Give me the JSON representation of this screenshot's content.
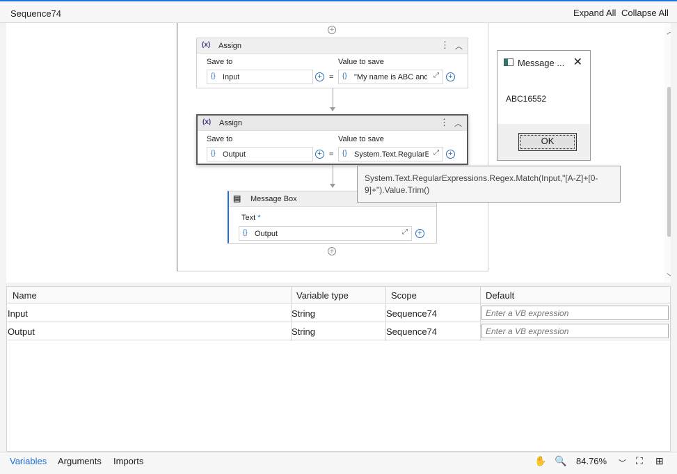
{
  "header": {
    "title": "Sequence74",
    "expand_all": "Expand All",
    "collapse_all": "Collapse All"
  },
  "workflow": {
    "assign1": {
      "title": "Assign",
      "save_to_label": "Save to",
      "value_label": "Value to save",
      "save_to_value": "Input",
      "value": "\"My name is ABC and"
    },
    "assign2": {
      "title": "Assign",
      "save_to_label": "Save to",
      "value_label": "Value to save",
      "save_to_value": "Output",
      "value": "System.Text.RegularExpres"
    },
    "messagebox": {
      "title": "Message Box",
      "text_label": "Text",
      "required_mark": "*",
      "text_value": "Output"
    },
    "tooltip": "System.Text.RegularExpressions.Regex.Match(Input,\"[A-Z]+[0-9]+\").Value.Trim()"
  },
  "dialog": {
    "title": "Message ...",
    "message": "ABC16552",
    "ok": "OK"
  },
  "variables": {
    "columns": [
      "Name",
      "Variable type",
      "Scope",
      "Default"
    ],
    "rows": [
      {
        "name": "Input",
        "type": "String",
        "scope": "Sequence74",
        "default_placeholder": "Enter a VB expression"
      },
      {
        "name": "Output",
        "type": "String",
        "scope": "Sequence74",
        "default_placeholder": "Enter a VB expression"
      }
    ]
  },
  "footer": {
    "tabs": [
      "Variables",
      "Arguments",
      "Imports"
    ],
    "zoom": "84.76%"
  },
  "colors": {
    "accent": "#1e6fd9",
    "variable_brace": "#2a6fb8"
  },
  "icons": [
    "hand-icon",
    "search-icon",
    "chevron-down-icon",
    "fit-screen-icon",
    "overview-icon",
    "dots-icon",
    "collapse-icon",
    "expand-editor-icon",
    "add-icon"
  ]
}
